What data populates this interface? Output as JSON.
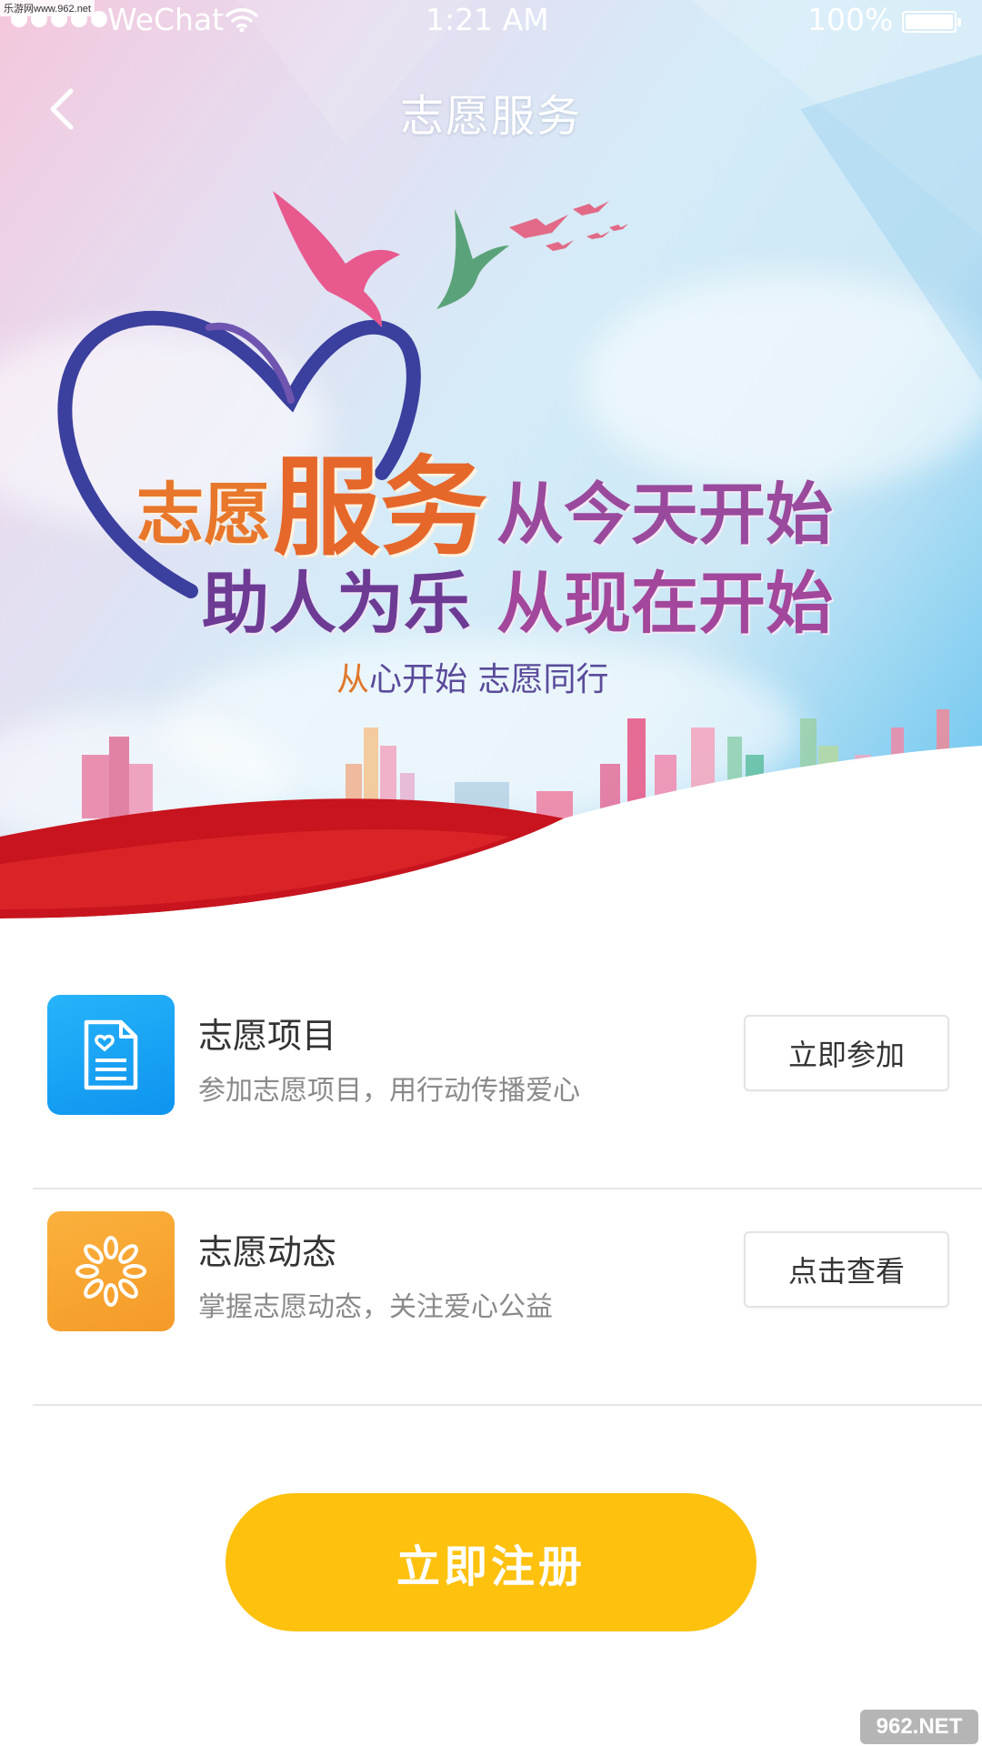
{
  "watermark_top": "乐游网www.962.net",
  "status_bar": {
    "carrier": "WeChat",
    "time": "1:21 AM",
    "battery": "100%"
  },
  "nav": {
    "title": "志愿服务",
    "back_icon": "chevron-left-icon"
  },
  "banner": {
    "line1_part1": "志愿",
    "line1_part2": "服务",
    "line1_part3": "从今天开始",
    "line2_part1": "助人为乐",
    "line2_part2": "从现在开始",
    "tagline_first": "从",
    "tagline_rest": "心开始 志愿同行"
  },
  "items": [
    {
      "name": "志愿项目",
      "description": "参加志愿项目，用行动传播爱心",
      "action": "立即参加",
      "icon": "document-heart-icon",
      "icon_color": "#169ff2"
    },
    {
      "name": "志愿动态",
      "description": "掌握志愿动态，关注爱心公益",
      "action": "点击查看",
      "icon": "sunburst-icon",
      "icon_color": "#f6a22e"
    }
  ],
  "register_button": "立即注册",
  "watermark_bottom": "962.NET",
  "colors": {
    "accent_yellow": "#fec10e",
    "blue": "#169ff2",
    "orange": "#f6a22e"
  }
}
